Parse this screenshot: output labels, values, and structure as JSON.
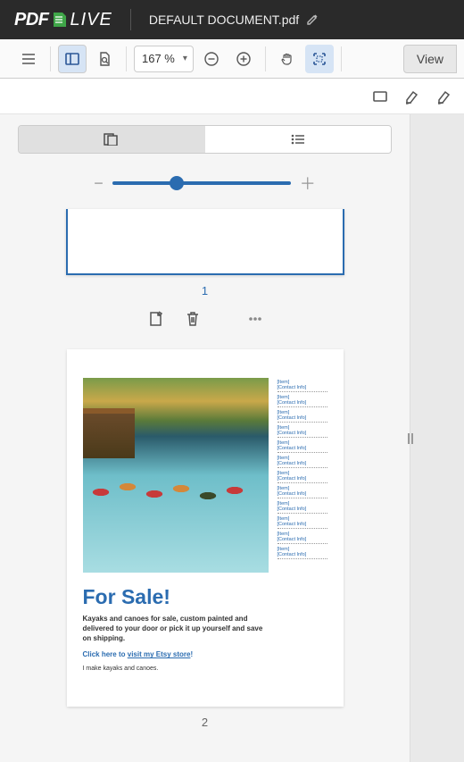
{
  "header": {
    "logo_pdf": "PDF",
    "logo_live": "LIVE",
    "doc_name": "DEFAULT DOCUMENT.pdf"
  },
  "toolbar": {
    "zoom_value": "167 %",
    "view_label": "View"
  },
  "thumb_panel": {
    "page1_num": "1",
    "page2_num": "2"
  },
  "page2": {
    "title": "For Sale!",
    "body": "Kayaks and canoes for sale, custom painted and delivered to your door or pick it up yourself and save on shipping.",
    "link_prefix": "Click here to ",
    "link_text": "visit my Etsy store",
    "link_suffix": "!",
    "small": "I make kayaks and canoes.",
    "contacts": [
      {
        "item": "[Item]",
        "info": "[Contact Info]"
      },
      {
        "item": "[Item]",
        "info": "[Contact Info]"
      },
      {
        "item": "[Item]",
        "info": "[Contact Info]"
      },
      {
        "item": "[Item]",
        "info": "[Contact Info]"
      },
      {
        "item": "[Item]",
        "info": "[Contact Info]"
      },
      {
        "item": "[Item]",
        "info": "[Contact Info]"
      },
      {
        "item": "[Item]",
        "info": "[Contact Info]"
      },
      {
        "item": "[Item]",
        "info": "[Contact Info]"
      },
      {
        "item": "[Item]",
        "info": "[Contact Info]"
      },
      {
        "item": "[Item]",
        "info": "[Contact Info]"
      },
      {
        "item": "[Item]",
        "info": "[Contact Info]"
      },
      {
        "item": "[Item]",
        "info": "[Contact Info]"
      }
    ]
  }
}
